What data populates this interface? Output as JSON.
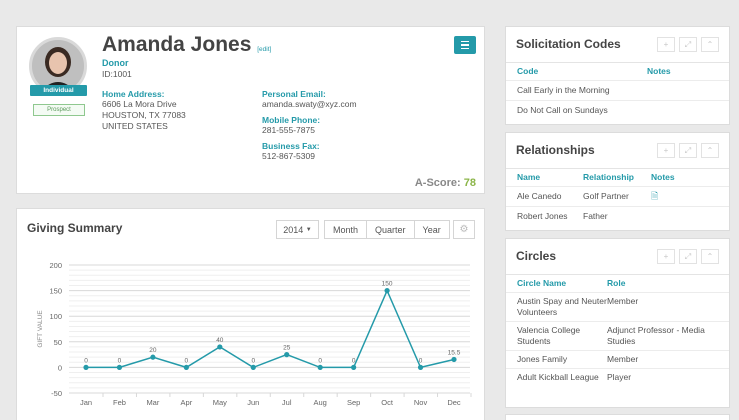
{
  "profile": {
    "name": "Amanda Jones",
    "edit_label": "[edit]",
    "type": "Donor",
    "id": "ID:1001",
    "badge_individual": "Individual",
    "badge_prospect": "Prospect",
    "home_address_label": "Home Address:",
    "home_address": [
      "6606 La Mora Drive",
      "HOUSTON, TX 77083",
      "UNITED STATES"
    ],
    "personal_email_label": "Personal Email:",
    "personal_email": "amanda.swaty@xyz.com",
    "mobile_phone_label": "Mobile Phone:",
    "mobile_phone": "281-555-7875",
    "business_fax_label": "Business Fax:",
    "business_fax": "512-867-5309",
    "ascore_label": "A-Score:",
    "ascore_value": "78"
  },
  "giving": {
    "title": "Giving Summary",
    "year": "2014",
    "periods": [
      "Month",
      "Quarter",
      "Year"
    ]
  },
  "chart_data": {
    "type": "line",
    "categories": [
      "Jan",
      "Feb",
      "Mar",
      "Apr",
      "May",
      "Jun",
      "Jul",
      "Aug",
      "Sep",
      "Oct",
      "Nov",
      "Dec"
    ],
    "values": [
      0,
      0,
      20,
      0,
      40,
      0,
      25,
      0,
      0,
      150,
      0,
      15.5
    ],
    "data_labels": [
      "0",
      "0",
      "20",
      "0",
      "40",
      "0",
      "25",
      "0",
      "0",
      "150",
      "0",
      "15.5"
    ],
    "ylabel": "GIFT VALUE",
    "yticks": [
      200,
      150,
      100,
      50,
      0,
      -50
    ],
    "ylim": [
      -50,
      200
    ],
    "grid": true,
    "color": "#249aa9"
  },
  "solicitation": {
    "title": "Solicitation Codes",
    "columns": [
      "Code",
      "Notes"
    ],
    "rows": [
      [
        "Call Early in the Morning",
        ""
      ],
      [
        "Do Not Call on Sundays",
        ""
      ]
    ]
  },
  "relationships": {
    "title": "Relationships",
    "columns": [
      "Name",
      "Relationship",
      "Notes"
    ],
    "rows": [
      [
        "Ale Canedo",
        "Golf Partner"
      ],
      [
        "Robert Jones",
        "Father"
      ]
    ]
  },
  "circles": {
    "title": "Circles",
    "columns": [
      "Circle Name",
      "Role"
    ],
    "rows": [
      [
        "Austin Spay and Neuter Volunteers",
        "Member"
      ],
      [
        "Valencia College Students",
        "Adjunct Professor - Media Studies"
      ],
      [
        "Jones Family",
        "Member"
      ],
      [
        "Adult Kickball League",
        "Player"
      ]
    ]
  },
  "colors": {
    "accent": "#249aa9",
    "score": "#8bb548"
  }
}
